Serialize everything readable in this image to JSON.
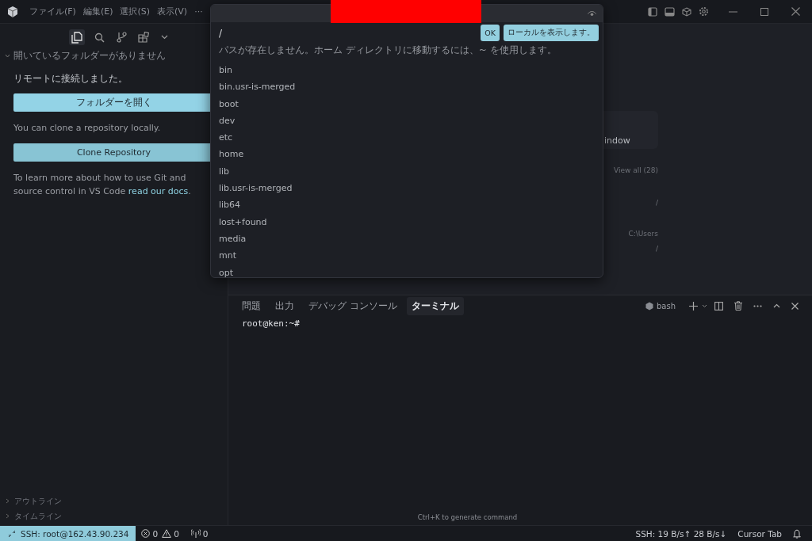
{
  "title_bar": {
    "menu": [
      {
        "label": "ファイル(F)"
      },
      {
        "label": "編集(E)"
      },
      {
        "label": "選択(S)"
      },
      {
        "label": "表示(V)"
      }
    ],
    "more": "···"
  },
  "sidebar": {
    "views": [
      {
        "kind": "files",
        "selected": true
      },
      {
        "kind": "search",
        "selected": false
      },
      {
        "kind": "source-control",
        "selected": false
      },
      {
        "kind": "extensions",
        "selected": false
      }
    ],
    "section": {
      "title": "開いているフォルダーがありません",
      "expanded": true
    },
    "message": "リモートに接続しました。",
    "open_button": "フォルダーを開く",
    "clone_text": "You can clone a repository locally.",
    "clone_button": "Clone Repository",
    "docs_text": "To learn more about how to use Git and source control in VS Code ",
    "docs_link": "read our docs",
    "docs_end": ".",
    "collapsed_sections": [
      {
        "label": "アウトライン",
        "expanded": false
      },
      {
        "label": "タイムライン",
        "expanded": false
      }
    ]
  },
  "welcome": {
    "card_text": "indow",
    "view_all": "View all (28)",
    "recent": [
      {
        "path": "/"
      },
      {
        "path": "C:\\Users"
      },
      {
        "path": "/"
      }
    ]
  },
  "quick_pick": {
    "value": "/",
    "message": "パスが存在しません。ホーム ディレクトリに移動するには、~ を使用します。",
    "buttons": [
      {
        "label": "OK"
      },
      {
        "label": "ローカルを表示します。"
      }
    ],
    "items": [
      "bin",
      "bin.usr-is-merged",
      "boot",
      "dev",
      "etc",
      "home",
      "lib",
      "lib.usr-is-merged",
      "lib64",
      "lost+found",
      "media",
      "mnt",
      "opt"
    ]
  },
  "panel": {
    "tabs": [
      {
        "label": "問題",
        "selected": false
      },
      {
        "label": "出力",
        "selected": false
      },
      {
        "label": "デバッグ コンソール",
        "selected": false
      },
      {
        "label": "ターミナル",
        "selected": true
      }
    ],
    "shell": "bash",
    "prompt": "root@ken:~#",
    "hint": "Ctrl+K to generate command"
  },
  "status_bar": {
    "remote": "SSH: root@162.43.90.234",
    "errors": "0",
    "warnings": "0",
    "ports": "0",
    "traffic": "SSH: 19 B/s↑ 28 B/s↓",
    "cursor_tab": "Cursor Tab"
  }
}
